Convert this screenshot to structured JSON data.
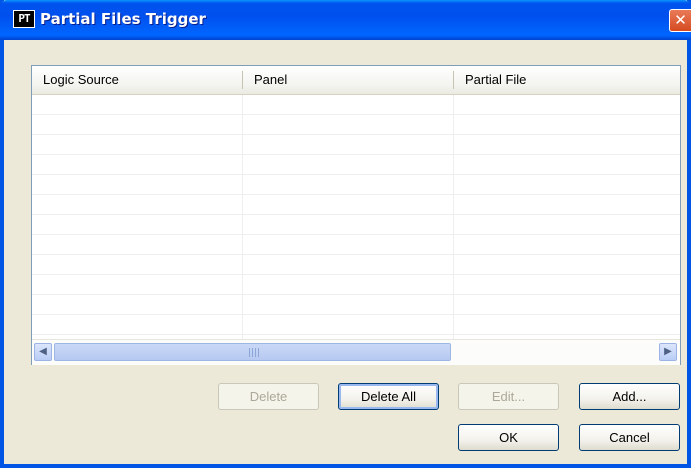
{
  "window": {
    "title": "Partial Files Trigger",
    "app_icon_text": "PT",
    "close_glyph": "✕"
  },
  "grid": {
    "columns": [
      "Logic Source",
      "Panel",
      "Partial File"
    ],
    "rows": [],
    "scroll_left_glyph": "◀",
    "scroll_right_glyph": "▶"
  },
  "buttons": {
    "delete": "Delete",
    "delete_all": "Delete All",
    "edit": "Edit...",
    "add": "Add...",
    "ok": "OK",
    "cancel": "Cancel"
  },
  "colors": {
    "titlebar": "#0055e5",
    "dialog_bg": "#ece9d8",
    "close_button": "#d54a20"
  }
}
